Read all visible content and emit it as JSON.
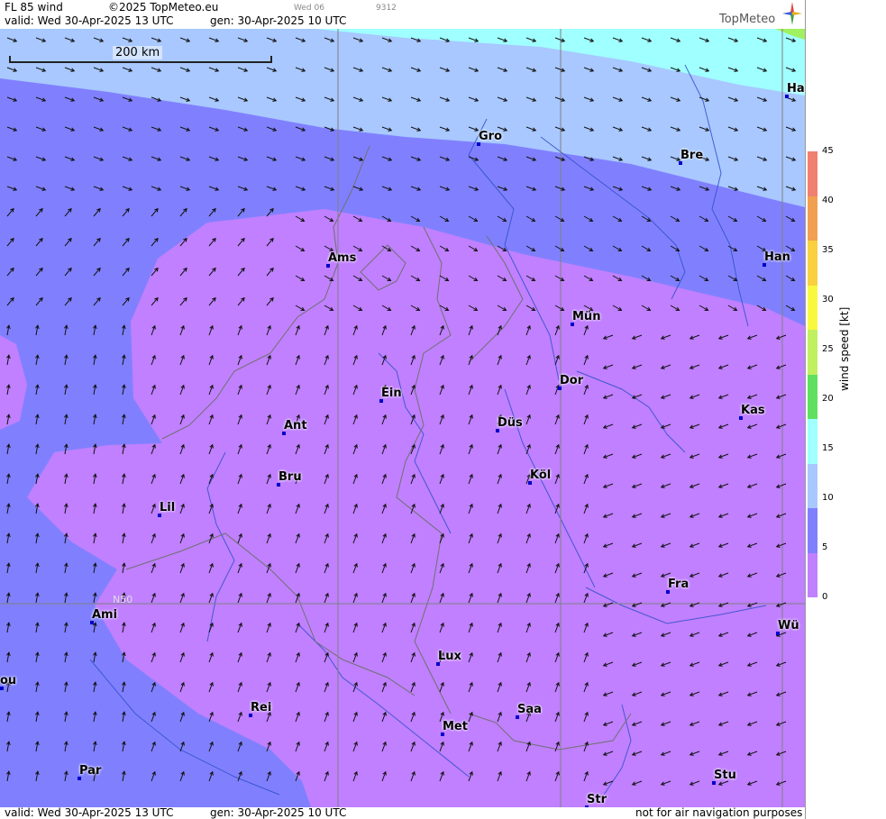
{
  "header": {
    "product": "FL 85 wind",
    "copyright": "©2025 TopMeteo.eu",
    "valid": "valid:  Wed  30-Apr-2025  13 UTC",
    "gen": "gen: 30-Apr-2025 10 UTC",
    "step": "Wed 06",
    "code": "9312",
    "logo": "TopMeteo"
  },
  "footer": {
    "valid": "valid:  Wed  30-Apr-2025  13 UTC",
    "gen": "gen: 30-Apr-2025 10 UTC",
    "note": "not for air navigation purposes"
  },
  "scale": {
    "label": "200 km"
  },
  "graticule_label": "N50",
  "legend": {
    "title": "wind  speed  [kt]",
    "ticks": [
      "45",
      "40",
      "35",
      "30",
      "25",
      "20",
      "15",
      "10",
      "5",
      "0"
    ],
    "colors": [
      "#f08070",
      "#f0a050",
      "#f8d040",
      "#f8f840",
      "#c0f060",
      "#60e060",
      "#a0ffff",
      "#a8c8ff",
      "#8080ff",
      "#c080ff"
    ]
  },
  "cities": [
    "Ha",
    "Gro",
    "Bre",
    "Ams",
    "Han",
    "Mün",
    "Ein",
    "Dor",
    "Kas",
    "Ant",
    "Düs",
    "Bru",
    "Köl",
    "Lil",
    "Fra",
    "Ami",
    "Wü",
    "Lux",
    "ou",
    "Rei",
    "Saa",
    "Met",
    "Par",
    "Stu",
    "Str"
  ]
}
